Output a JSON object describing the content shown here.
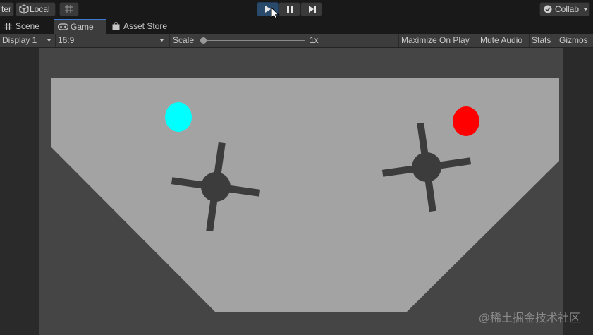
{
  "toolbar": {
    "pivot_label": "ter",
    "local_label": "Local",
    "collab_label": "Collab",
    "colors": {
      "play_active": "#2a4a6b"
    }
  },
  "tabs": [
    {
      "label": "Scene",
      "icon": "grid-icon"
    },
    {
      "label": "Game",
      "icon": "gamepad-icon"
    },
    {
      "label": "Asset Store",
      "icon": "store-bag-icon"
    }
  ],
  "game_toolbar": {
    "display": "Display 1",
    "aspect": "16:9",
    "scale_label": "Scale",
    "scale_value": "1x",
    "scale_slider_level": 0,
    "maximize": "Maximize On Play",
    "mute": "Mute Audio",
    "stats": "Stats",
    "gizmos": "Gizmos"
  },
  "scene": {
    "colors": {
      "ground": "#a3a3a3",
      "spinner": "#3c3c3c",
      "ball_left": "#00ffff",
      "ball_right": "#ff0000",
      "background": "#454545"
    }
  },
  "watermark": "@稀土掘金技术社区"
}
